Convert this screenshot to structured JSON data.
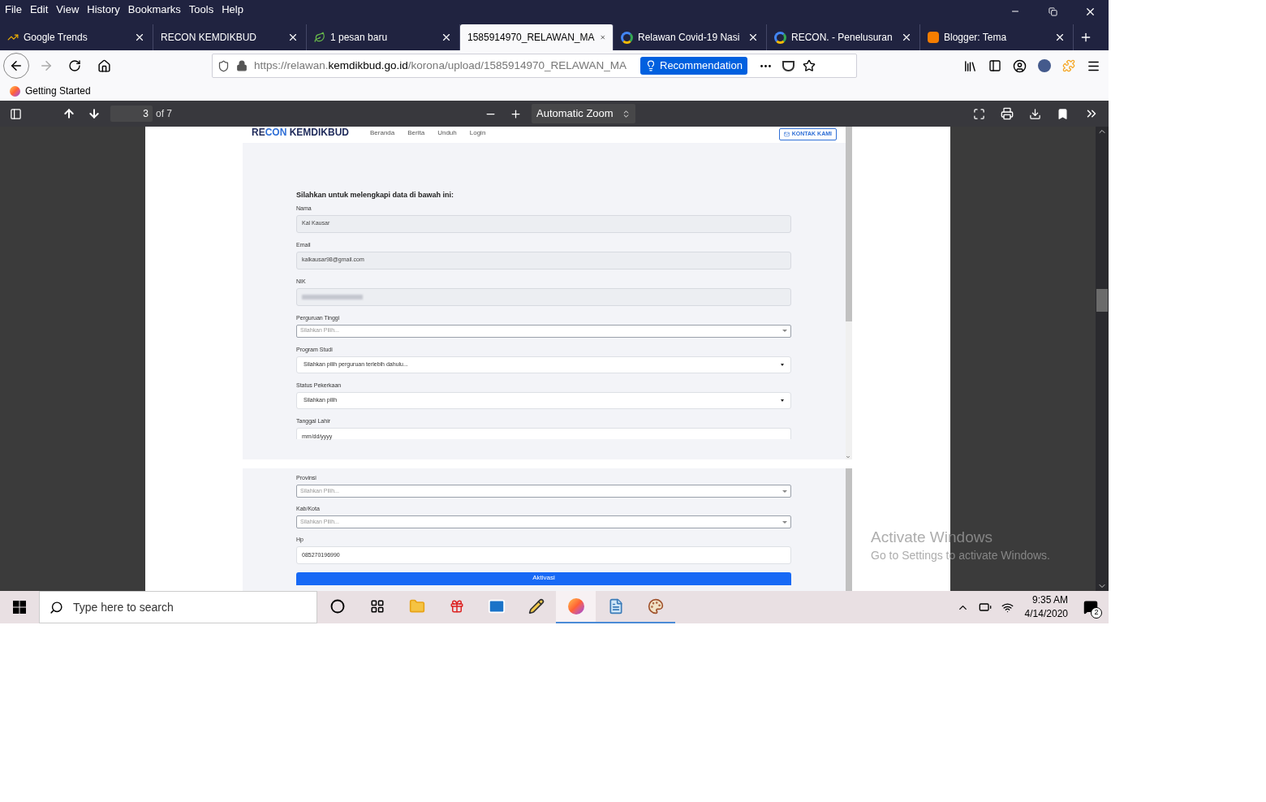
{
  "menu": [
    "File",
    "Edit",
    "View",
    "History",
    "Bookmarks",
    "Tools",
    "Help"
  ],
  "tabs": [
    {
      "label": "Google Trends",
      "selected": false,
      "kind": "trends"
    },
    {
      "label": "RECON KEMDIKBUD",
      "selected": false,
      "kind": "plain"
    },
    {
      "label": "1 pesan baru",
      "selected": false,
      "kind": "leaf"
    },
    {
      "label": "1585914970_RELAWAN_MA",
      "selected": true,
      "kind": "plain"
    },
    {
      "label": "Relawan Covid-19 Nasi",
      "selected": false,
      "kind": "google"
    },
    {
      "label": "RECON. - Penelusuran",
      "selected": false,
      "kind": "google"
    },
    {
      "label": "Blogger: Tema",
      "selected": false,
      "kind": "blogger"
    }
  ],
  "address_bar": {
    "prefix": "https://relawan.",
    "domain": "kemdikbud.go.id",
    "path": "/korona/upload/1585914970_RELAWAN_MA",
    "recommendation": "Recommendation"
  },
  "bookmarks": [
    "Getting Started"
  ],
  "pdf_toolbar": {
    "page": "3",
    "page_count": "of 7",
    "zoom": "Automatic Zoom"
  },
  "document": {
    "brand": [
      {
        "text": "RE",
        "color": "#1e2a5a"
      },
      {
        "text": "CON",
        "color": "#2f6fd6"
      },
      {
        "text": " KEMDIKBUD",
        "color": "#1e2a5a"
      }
    ],
    "nav": [
      "Beranda",
      "Berita",
      "Unduh",
      "Login"
    ],
    "contact_button": "KONTAK KAMI",
    "heading": "Silahkan untuk melengkapi data di bawah ini:",
    "fields": [
      {
        "kind": "readonly",
        "label": "Nama",
        "value": "Kal Kausar"
      },
      {
        "kind": "readonly",
        "label": "Email",
        "value": "kalkausar98@gmail.com"
      },
      {
        "kind": "blurred",
        "label": "NIK"
      },
      {
        "kind": "combo",
        "label": "Perguruan Tinggi",
        "placeholder": "Silahkan Pilih..."
      },
      {
        "kind": "select",
        "label": "Program Studi",
        "value": "Silahkan pilih perguruan terlebih dahulu..."
      },
      {
        "kind": "select",
        "label": "Status Pekerkaan",
        "value": "Silahkan pilih"
      },
      {
        "kind": "date",
        "label": "Tanggal Lahir",
        "placeholder": "mm/dd/yyyy"
      }
    ],
    "fields_2": [
      {
        "kind": "combo",
        "label": "Provinsi",
        "placeholder": "Silahkan Pilih..."
      },
      {
        "kind": "combo",
        "label": "Kab/Kota",
        "placeholder": "Silahkan Pilih..."
      },
      {
        "kind": "input",
        "label": "Hp",
        "value": "085270196990"
      }
    ],
    "submit": "Aktivasi"
  },
  "activation_notice": {
    "title": "Activate Windows",
    "text": "Go to Settings to activate Windows."
  },
  "taskbar": {
    "search_placeholder": "Type here to search",
    "apps": [
      {
        "kind": "cortana",
        "running": false,
        "active": false
      },
      {
        "kind": "taskview",
        "running": false,
        "active": false
      },
      {
        "kind": "folder",
        "running": false,
        "active": false
      },
      {
        "kind": "gift",
        "running": false,
        "active": false
      },
      {
        "kind": "mail",
        "running": false,
        "active": false
      },
      {
        "kind": "pencil",
        "running": false,
        "active": false
      },
      {
        "kind": "firefox",
        "running": true,
        "active": true
      },
      {
        "kind": "notepad",
        "running": true,
        "active": false
      },
      {
        "kind": "paint",
        "running": true,
        "active": false
      }
    ],
    "time": "9:35 AM",
    "date": "4/14/2020",
    "notifications": "2"
  }
}
